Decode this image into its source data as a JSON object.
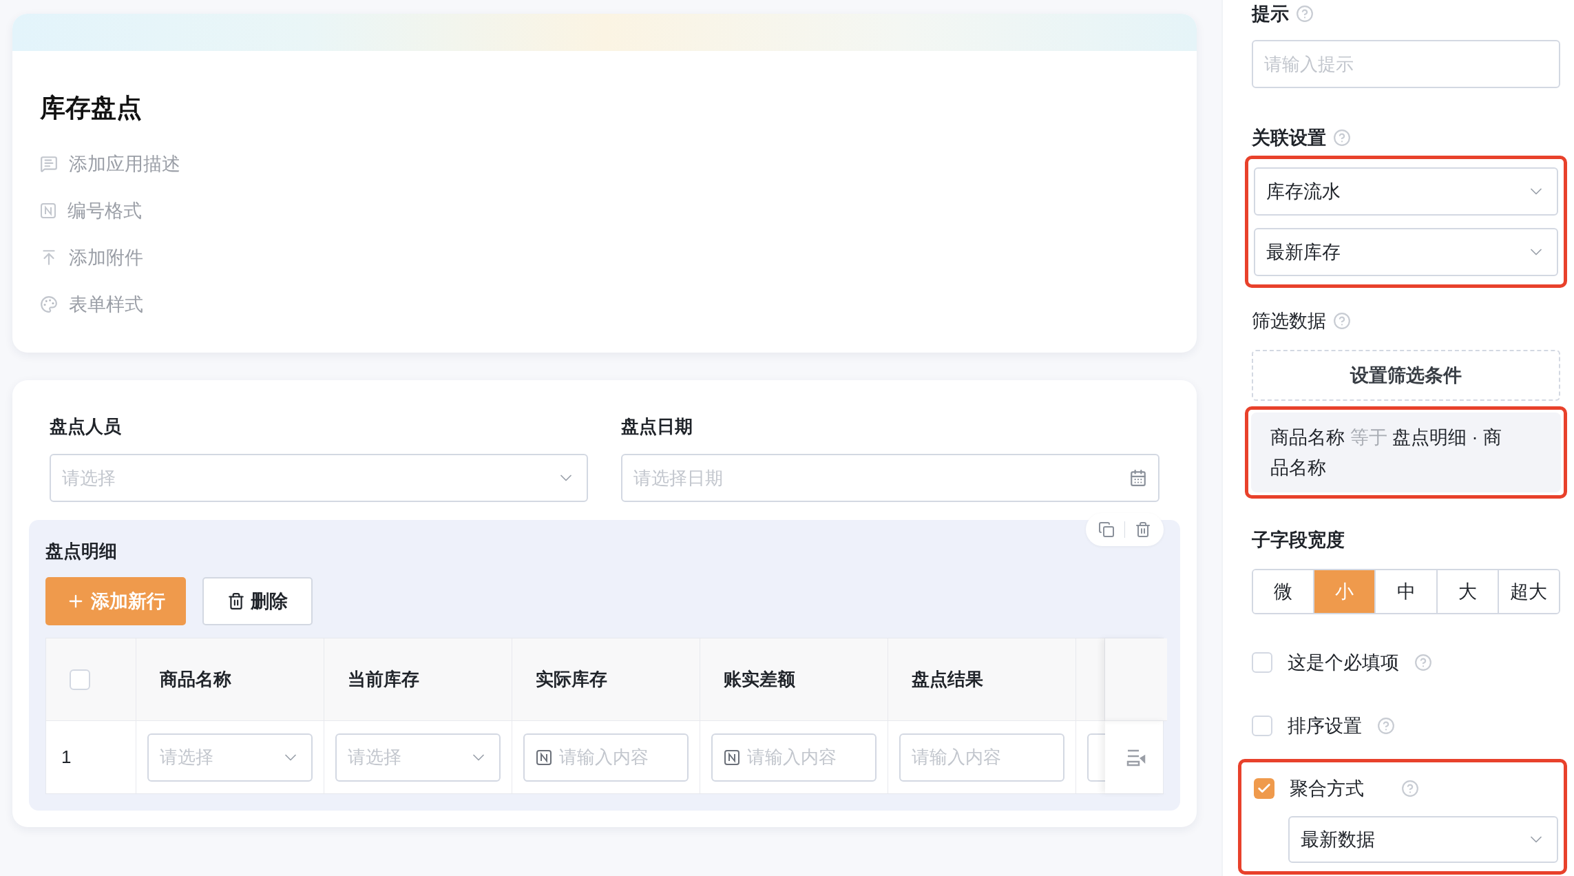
{
  "app": {
    "title": "库存盘点",
    "actions": [
      {
        "kind": "comment",
        "label": "添加应用描述"
      },
      {
        "kind": "number",
        "label": "编号格式"
      },
      {
        "kind": "upload",
        "label": "添加附件"
      },
      {
        "kind": "palette",
        "label": "表单样式"
      }
    ]
  },
  "form": {
    "fields": [
      {
        "label": "盘点人员",
        "kind": "select",
        "placeholder": "请选择"
      },
      {
        "label": "盘点日期",
        "kind": "date",
        "placeholder": "请选择日期"
      }
    ],
    "subtable": {
      "title": "盘点明细",
      "add_button": "添加新行",
      "delete_button": "删除",
      "header_checked": false,
      "columns": [
        "商品名称",
        "当前库存",
        "实际库存",
        "账实差额",
        "盘点结果"
      ],
      "rows": [
        {
          "index": "1",
          "cells": [
            {
              "kind": "select",
              "placeholder": "请选择"
            },
            {
              "kind": "select",
              "placeholder": "请选择"
            },
            {
              "kind": "number",
              "placeholder": "请输入内容"
            },
            {
              "kind": "number",
              "placeholder": "请输入内容"
            },
            {
              "kind": "text",
              "placeholder": "请输入内容"
            }
          ]
        }
      ]
    }
  },
  "settings": {
    "hint": {
      "label": "提示",
      "placeholder": "请输入提示"
    },
    "relation": {
      "label": "关联设置",
      "highlighted": true,
      "selects": [
        "库存流水",
        "最新库存"
      ]
    },
    "filter": {
      "label": "筛选数据",
      "button": "设置筛选条件",
      "condition": {
        "highlighted": true,
        "field": "商品名称",
        "operator": "等于",
        "value": "盘点明细 · 商品名称"
      }
    },
    "width": {
      "label": "子字段宽度",
      "options": [
        {
          "label": "微",
          "selected": false
        },
        {
          "label": "小",
          "selected": true
        },
        {
          "label": "中",
          "selected": false
        },
        {
          "label": "大",
          "selected": false
        },
        {
          "label": "超大",
          "selected": false
        }
      ]
    },
    "options": [
      {
        "label": "这是个必填项",
        "checked": false
      },
      {
        "label": "排序设置",
        "checked": false
      }
    ],
    "aggregation": {
      "label": "聚合方式",
      "checked": true,
      "highlighted": true,
      "value": "最新数据"
    }
  }
}
